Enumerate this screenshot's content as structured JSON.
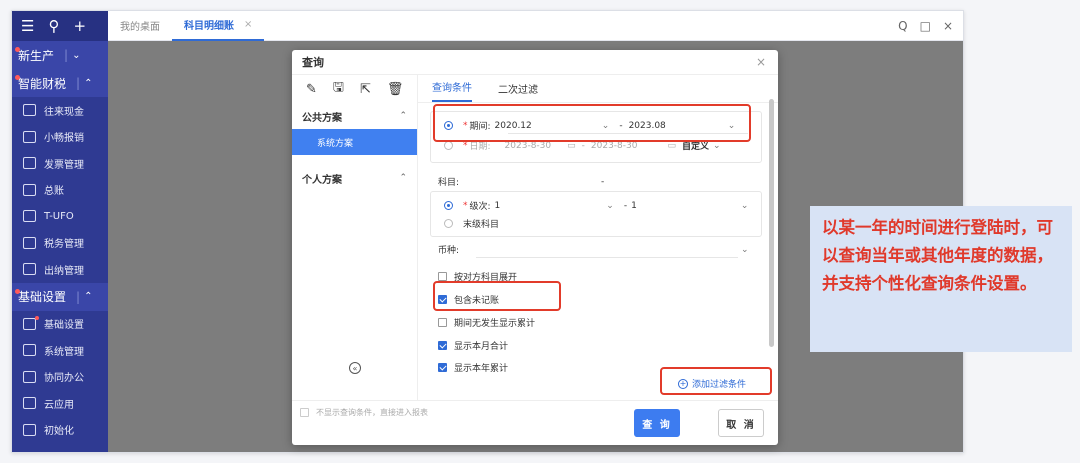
{
  "sidebar": {
    "top_icons": [
      "menu-icon",
      "search-icon",
      "plus-icon"
    ],
    "sections": [
      {
        "label": "新生产",
        "items": []
      },
      {
        "label": "智能财税",
        "items": [
          "往来现金",
          "小畅报销",
          "发票管理",
          "总账",
          "T-UFO",
          "税务管理",
          "出纳管理"
        ]
      },
      {
        "label": "基础设置",
        "items": [
          "基础设置",
          "系统管理",
          "协同办公",
          "云应用",
          "初始化"
        ]
      }
    ]
  },
  "tabs": {
    "home": "我的桌面",
    "active": "科目明细账",
    "close": "×"
  },
  "window_controls": [
    "Q",
    "□",
    "×"
  ],
  "dialog": {
    "title": "查询",
    "close": "×",
    "left": {
      "public_plan": "公共方案",
      "system_plan": "系统方案",
      "personal_plan": "个人方案"
    },
    "tabs": [
      "查询条件",
      "二次过滤"
    ],
    "period": {
      "label": "期间:",
      "from": "2020.12",
      "separator": "-",
      "to": "2023.08"
    },
    "date": {
      "label": "日期:",
      "from": "2023-8-30",
      "separator": "-",
      "to": "2023-8-30",
      "mode": "自定义"
    },
    "subject": {
      "label": "科目:",
      "value": "-"
    },
    "level": {
      "label": "级次:",
      "from": "1",
      "separator": "-",
      "to": "1",
      "leaf_label": "末级科目"
    },
    "currency": {
      "label": "币种:"
    },
    "options": [
      {
        "label": "按对方科目展开",
        "checked": false
      },
      {
        "label": "包含未记账",
        "checked": true
      },
      {
        "label": "期间无发生显示累计",
        "checked": false
      },
      {
        "label": "显示本月合计",
        "checked": true
      },
      {
        "label": "显示本年累计",
        "checked": true
      }
    ],
    "add_filter": "添加过滤条件",
    "footer": {
      "skip_check": "不显示查询条件，直接进入报表",
      "query": "查 询",
      "cancel": "取 消"
    }
  },
  "callout": {
    "text": "以某一年的时间进行登陆时，可以查询当年或其他年度的数据，并支持个性化查询条件设置。",
    "color": "#e0392b",
    "background": "#d8e3f5"
  },
  "colors": {
    "sidebar": "#2f3a92",
    "accent": "#2f6bd6",
    "highlight": "#e23b2a"
  }
}
